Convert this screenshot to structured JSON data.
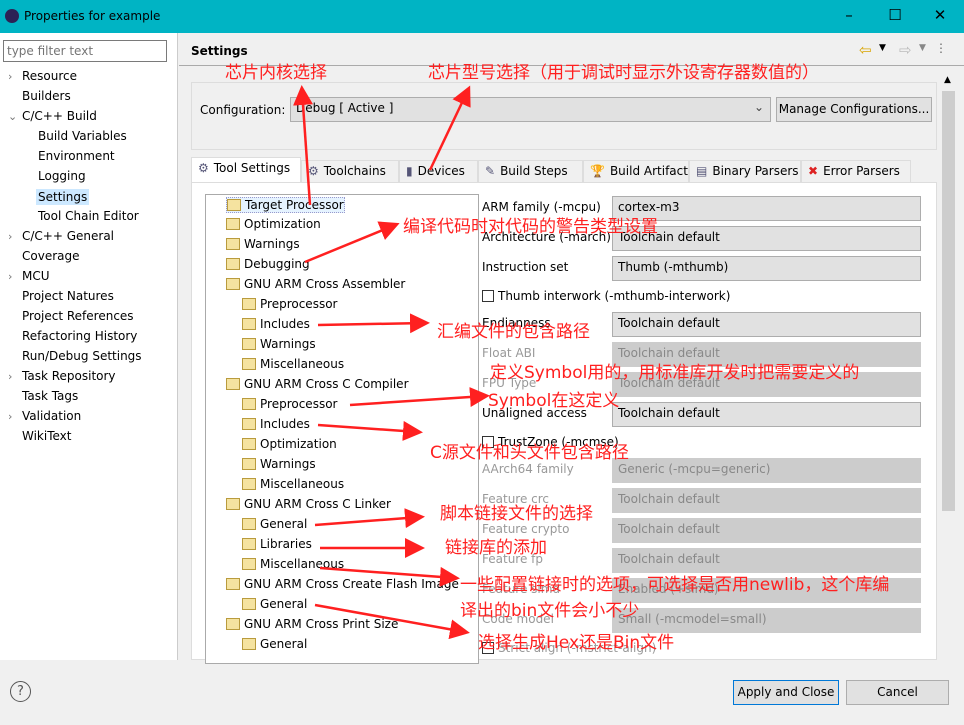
{
  "window": {
    "title": "Properties for example",
    "minimize": "–",
    "maximize": "☐",
    "close": "✕"
  },
  "filter": {
    "placeholder": "type filter text"
  },
  "nav": [
    {
      "label": "Resource",
      "expander": "›"
    },
    {
      "label": "Builders"
    },
    {
      "label": "C/C++ Build",
      "expander": "⌄"
    },
    {
      "label": "Build Variables",
      "child": true
    },
    {
      "label": "Environment",
      "child": true
    },
    {
      "label": "Logging",
      "child": true
    },
    {
      "label": "Settings",
      "child": true,
      "selected": true
    },
    {
      "label": "Tool Chain Editor",
      "child": true
    },
    {
      "label": "C/C++ General",
      "expander": "›"
    },
    {
      "label": "Coverage"
    },
    {
      "label": "MCU",
      "expander": "›"
    },
    {
      "label": "Project Natures"
    },
    {
      "label": "Project References"
    },
    {
      "label": "Refactoring History"
    },
    {
      "label": "Run/Debug Settings"
    },
    {
      "label": "Task Repository",
      "expander": "›"
    },
    {
      "label": "Task Tags"
    },
    {
      "label": "Validation",
      "expander": "›"
    },
    {
      "label": "WikiText"
    }
  ],
  "page": {
    "title": "Settings",
    "back": "⇦",
    "forward": "⇨",
    "menu": "⋮"
  },
  "config": {
    "label": "Configuration:",
    "value": "Debug  [ Active ]",
    "manage": "Manage Configurations..."
  },
  "tabs": [
    {
      "label": "Tool Settings",
      "icon": "⚙"
    },
    {
      "label": "Toolchains",
      "icon": "⚙"
    },
    {
      "label": "Devices",
      "icon": "▮"
    },
    {
      "label": "Build Steps",
      "icon": "✎"
    },
    {
      "label": "Build Artifact",
      "icon": "🏆"
    },
    {
      "label": "Binary Parsers",
      "icon": "▤"
    },
    {
      "label": "Error Parsers",
      "icon": "✖"
    }
  ],
  "tree": [
    {
      "label": "Target Processor",
      "level": 1,
      "selected": true
    },
    {
      "label": "Optimization",
      "level": 1
    },
    {
      "label": "Warnings",
      "level": 1
    },
    {
      "label": "Debugging",
      "level": 1
    },
    {
      "label": "GNU ARM Cross Assembler",
      "level": 0
    },
    {
      "label": "Preprocessor",
      "level": 2
    },
    {
      "label": "Includes",
      "level": 2
    },
    {
      "label": "Warnings",
      "level": 2
    },
    {
      "label": "Miscellaneous",
      "level": 2
    },
    {
      "label": "GNU ARM Cross C Compiler",
      "level": 0
    },
    {
      "label": "Preprocessor",
      "level": 2
    },
    {
      "label": "Includes",
      "level": 2
    },
    {
      "label": "Optimization",
      "level": 2
    },
    {
      "label": "Warnings",
      "level": 2
    },
    {
      "label": "Miscellaneous",
      "level": 2
    },
    {
      "label": "GNU ARM Cross C Linker",
      "level": 0
    },
    {
      "label": "General",
      "level": 2
    },
    {
      "label": "Libraries",
      "level": 2
    },
    {
      "label": "Miscellaneous",
      "level": 2
    },
    {
      "label": "GNU ARM Cross Create Flash Image",
      "level": 0
    },
    {
      "label": "General",
      "level": 2
    },
    {
      "label": "GNU ARM Cross Print Size",
      "level": 0
    },
    {
      "label": "General",
      "level": 2
    }
  ],
  "form": [
    {
      "label": "ARM family (-mcpu)",
      "value": "cortex-m3",
      "type": "select"
    },
    {
      "label": "Architecture (-march)",
      "value": "Toolchain default",
      "type": "select"
    },
    {
      "label": "Instruction set",
      "value": "Thumb (-mthumb)",
      "type": "select"
    },
    {
      "label": "Thumb interwork (-mthumb-interwork)",
      "type": "checkbox",
      "checked": false
    },
    {
      "label": "Endianness",
      "value": "Toolchain default",
      "type": "select"
    },
    {
      "label": "Float ABI",
      "value": "Toolchain default",
      "type": "select",
      "disabled": true
    },
    {
      "label": "FPU Type",
      "value": "Toolchain default",
      "type": "select",
      "disabled": true
    },
    {
      "label": "Unaligned access",
      "value": "Toolchain default",
      "type": "select"
    },
    {
      "label": "TrustZone (-mcmse)",
      "type": "checkbox",
      "checked": false
    },
    {
      "label": "AArch64 family",
      "value": "Generic (-mcpu=generic)",
      "type": "select",
      "disabled": true
    },
    {
      "label": "Feature crc",
      "value": "Toolchain default",
      "type": "select",
      "disabled": true
    },
    {
      "label": "Feature crypto",
      "value": "Toolchain default",
      "type": "select",
      "disabled": true
    },
    {
      "label": "Feature fp",
      "value": "Toolchain default",
      "type": "select",
      "disabled": true
    },
    {
      "label": "Feature simd",
      "value": "Enabled (+simd)",
      "type": "select",
      "disabled": true
    },
    {
      "label": "Code model",
      "value": "Small (-mcmodel=small)",
      "type": "select",
      "disabled": true
    },
    {
      "label": "Strict align (-mstrict-align)",
      "type": "checkbox",
      "checked": false,
      "disabled": true
    }
  ],
  "footer": {
    "help": "?",
    "apply": "Apply and Close",
    "cancel": "Cancel"
  },
  "annotations": [
    "芯片内核选择",
    "芯片型号选择（用于调试时显示外设寄存器数值的）",
    "编译代码时对代码的警告类型设置",
    "汇编文件的包含路径",
    "定义Symbol用的，用标准库开发时把需要定义的",
    "Symbol在这定义",
    "C源文件和头文件包含路径",
    "脚本链接文件的选择",
    "链接库的添加",
    "一些配置链接时的选项，可选择是否用newlib，这个库编",
    "译出的bin文件会小不少",
    "选择生成Hex还是Bin文件"
  ],
  "colors": {
    "titlebar": "#00b4c4",
    "annotation": "#ff2020"
  }
}
